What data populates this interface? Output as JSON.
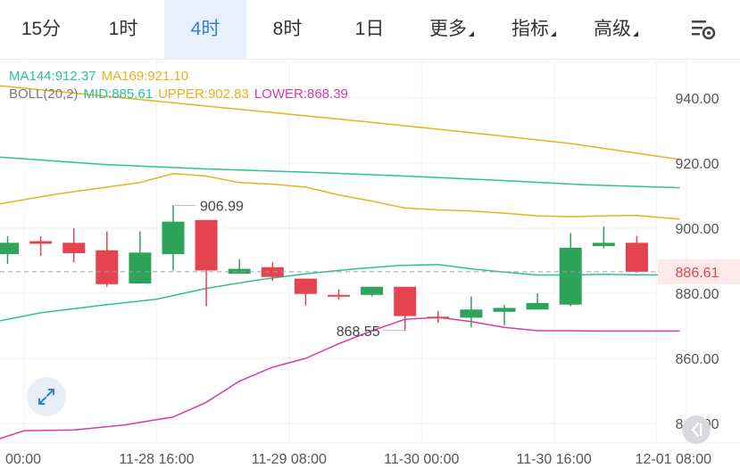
{
  "tabs": [
    {
      "label": "15分",
      "active": false,
      "dropdown": false
    },
    {
      "label": "1时",
      "active": false,
      "dropdown": false
    },
    {
      "label": "4时",
      "active": true,
      "dropdown": false
    },
    {
      "label": "8时",
      "active": false,
      "dropdown": false
    },
    {
      "label": "1日",
      "active": false,
      "dropdown": false
    },
    {
      "label": "更多",
      "active": false,
      "dropdown": true
    },
    {
      "label": "指标",
      "active": false,
      "dropdown": true
    },
    {
      "label": "高级",
      "active": false,
      "dropdown": true
    }
  ],
  "legend": {
    "ma144": "MA144:912.37",
    "ma169": "MA169:921.10",
    "boll": "BOLL(20,2)",
    "mid": "MID:885.61",
    "upper": "UPPER:902.83",
    "lower": "LOWER:868.39"
  },
  "colors": {
    "up": "#2ea35a",
    "down": "#e5434f",
    "ma144": "#2cbf9a",
    "ma169": "#e6b21e",
    "boll_mid": "#2cbf9a",
    "boll_upper": "#e6b21e",
    "boll_lower": "#d63ba8",
    "accent": "#2f7de1",
    "price_tag": "#e5434f"
  },
  "icons": {
    "settings": "chart-settings-icon",
    "expand": "expand-arrows-icon",
    "back": "back-to-latest-icon"
  },
  "chart_data": {
    "type": "candlestick",
    "y_ticks": [
      "940.00",
      "920.00",
      "900.00",
      "880.00",
      "860.00",
      "840.00"
    ],
    "ylim": [
      834,
      952
    ],
    "x_ticks": [
      "00:00",
      "11-28 16:00",
      "11-29 08:00",
      "11-30 00:00",
      "11-30 16:00",
      "12-01 08:00"
    ],
    "x_tick_index": [
      0.5,
      4.5,
      8.5,
      12.5,
      16.5,
      20.5
    ],
    "grid": true,
    "current_price": {
      "label": "886.61",
      "value": 886.61
    },
    "annotations": [
      {
        "label": "906.99",
        "index": 5,
        "value": 906.99,
        "side": "right"
      },
      {
        "label": "868.55",
        "index": 12,
        "value": 868.55,
        "side": "left"
      }
    ],
    "candles": [
      {
        "open": 892.0,
        "close": 895.5,
        "high": 897.5,
        "low": 889.0
      },
      {
        "open": 896.0,
        "close": 895.2,
        "high": 897.5,
        "low": 891.5
      },
      {
        "open": 895.5,
        "close": 892.3,
        "high": 900.0,
        "low": 889.5
      },
      {
        "open": 893.2,
        "close": 882.8,
        "high": 899.0,
        "low": 882.0
      },
      {
        "open": 883.0,
        "close": 892.5,
        "high": 899.0,
        "low": 883.0
      },
      {
        "open": 892.0,
        "close": 902.0,
        "high": 907.0,
        "low": 887.0
      },
      {
        "open": 902.5,
        "close": 887.0,
        "high": 902.5,
        "low": 876.0
      },
      {
        "open": 886.0,
        "close": 887.5,
        "high": 890.5,
        "low": 886.0
      },
      {
        "open": 888.0,
        "close": 885.0,
        "high": 889.5,
        "low": 883.8
      },
      {
        "open": 884.5,
        "close": 879.8,
        "high": 884.5,
        "low": 876.2
      },
      {
        "open": 879.5,
        "close": 879.0,
        "high": 881.2,
        "low": 878.0
      },
      {
        "open": 879.5,
        "close": 882.0,
        "high": 882.0,
        "low": 879.0
      },
      {
        "open": 882.0,
        "close": 873.0,
        "high": 882.0,
        "low": 868.5
      },
      {
        "open": 872.8,
        "close": 872.6,
        "high": 874.5,
        "low": 871.0
      },
      {
        "open": 872.5,
        "close": 875.0,
        "high": 879.0,
        "low": 869.5
      },
      {
        "open": 874.3,
        "close": 875.5,
        "high": 876.5,
        "low": 870.2
      },
      {
        "open": 875.0,
        "close": 877.0,
        "high": 880.0,
        "low": 875.0
      },
      {
        "open": 876.5,
        "close": 894.0,
        "high": 898.5,
        "low": 876.0
      },
      {
        "open": 894.5,
        "close": 895.5,
        "high": 900.5,
        "low": 893.8
      },
      {
        "open": 895.5,
        "close": 886.6,
        "high": 897.5,
        "low": 886.3
      }
    ],
    "series": [
      {
        "name": "MA169",
        "key": "ma169",
        "values": [
          [
            -0.5,
            944
          ],
          [
            2,
            941.5
          ],
          [
            5,
            938.5
          ],
          [
            8,
            935.5
          ],
          [
            11,
            932.5
          ],
          [
            14,
            929.3
          ],
          [
            17,
            926
          ],
          [
            20.3,
            921.1
          ]
        ]
      },
      {
        "name": "MA144",
        "key": "ma144",
        "values": [
          [
            -0.5,
            922
          ],
          [
            3,
            919.5
          ],
          [
            6,
            918.2
          ],
          [
            9,
            917.2
          ],
          [
            12,
            916
          ],
          [
            15,
            914.6
          ],
          [
            17.5,
            913.3
          ],
          [
            20.3,
            912.4
          ]
        ]
      },
      {
        "name": "UPPER",
        "key": "boll_upper",
        "values": [
          [
            -0.5,
            907
          ],
          [
            1.5,
            910.5
          ],
          [
            3,
            912.6
          ],
          [
            4,
            914
          ],
          [
            5,
            916.8
          ],
          [
            6,
            916
          ],
          [
            7,
            914
          ],
          [
            8,
            913.5
          ],
          [
            9,
            912.6
          ],
          [
            10,
            910.2
          ],
          [
            11,
            908.3
          ],
          [
            12,
            906.2
          ],
          [
            13,
            905.6
          ],
          [
            14,
            905.3
          ],
          [
            15,
            904.6
          ],
          [
            16,
            903.8
          ],
          [
            17,
            903.5
          ],
          [
            18,
            903.8
          ],
          [
            19,
            903.9
          ],
          [
            20.3,
            902.8
          ]
        ]
      },
      {
        "name": "MID",
        "key": "boll_mid",
        "values": [
          [
            -0.5,
            871
          ],
          [
            1,
            874
          ],
          [
            3,
            876.5
          ],
          [
            4.5,
            878.2
          ],
          [
            6,
            881.5
          ],
          [
            7.5,
            884
          ],
          [
            9,
            886
          ],
          [
            10.5,
            887.5
          ],
          [
            11.8,
            888.5
          ],
          [
            13,
            888.8
          ],
          [
            14,
            887.5
          ],
          [
            15,
            886.5
          ],
          [
            16,
            885.6
          ],
          [
            17,
            885.6
          ],
          [
            18,
            885.8
          ],
          [
            19,
            885.7
          ],
          [
            20.3,
            885.6
          ]
        ]
      },
      {
        "name": "LOWER",
        "key": "boll_lower",
        "values": [
          [
            -0.5,
            834.5
          ],
          [
            0.5,
            837.8
          ],
          [
            2,
            838
          ],
          [
            3.5,
            839.5
          ],
          [
            5,
            842
          ],
          [
            6,
            846.5
          ],
          [
            7,
            853
          ],
          [
            8,
            857.3
          ],
          [
            9,
            860
          ],
          [
            10,
            864.5
          ],
          [
            11,
            868.5
          ],
          [
            12,
            872
          ],
          [
            13,
            872.6
          ],
          [
            14,
            871.3
          ],
          [
            15,
            869.5
          ],
          [
            16,
            868.5
          ],
          [
            17,
            868.5
          ],
          [
            18,
            868.4
          ],
          [
            20.3,
            868.4
          ]
        ]
      }
    ]
  }
}
